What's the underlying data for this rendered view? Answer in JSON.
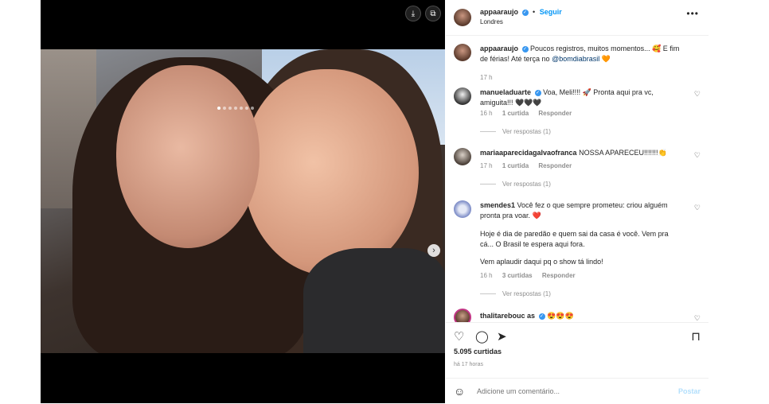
{
  "post": {
    "username": "appaaraujo",
    "follow_label": "Seguir",
    "location": "Londres",
    "caption_text": "Poucos registros, muitos momentos... 🥰 E fim de férias! Até terça no ",
    "caption_mention": "@bomdiabrasil",
    "caption_end": " 🧡",
    "caption_time": "17 h",
    "likes": "5.095 curtidas",
    "posted_ago": "há 17 horas"
  },
  "media": {
    "carousel_dots": 7,
    "active_dot": 1
  },
  "comments": [
    {
      "username": "manueladuarte",
      "verified": true,
      "text": "Voa, Meli!!!! 🚀 Pronta aqui pra vc, amiguita!!! 🖤🖤🖤",
      "time": "16 h",
      "likes": "1 curtida",
      "reply_label": "Responder",
      "view_replies": "Ver respostas (1)"
    },
    {
      "username": "mariaaparecidagalvaofranca",
      "verified": false,
      "text": "NOSSA APARECEU!!!!!!!👏",
      "time": "17 h",
      "likes": "1 curtida",
      "reply_label": "Responder",
      "view_replies": "Ver respostas (1)"
    },
    {
      "username": "smendes1",
      "verified": false,
      "text": "Você fez o que sempre prometeu: criou alguém pronta pra voar. ❤️",
      "text2": "Hoje é dia de paredão e quem sai da casa é você. Vem pra cá... O Brasil te espera aqui fora.",
      "text3": "Vem aplaudir daqui pq o show tá lindo!",
      "time": "16 h",
      "likes": "3 curtidas",
      "reply_label": "Responder",
      "view_replies": "Ver respostas (1)"
    },
    {
      "username": "thalitarebouc as",
      "verified": true,
      "text": "😍😍😍"
    }
  ],
  "comment_box": {
    "placeholder": "Adicione um comentário...",
    "post_label": "Postar"
  },
  "icons": {
    "heart": "♡",
    "comment": "◯",
    "share": "➤",
    "bookmark": "⊓",
    "emoji": "☺",
    "more": "•••",
    "next": "›",
    "download": "⤓",
    "external": "⧉"
  },
  "colors": {
    "accent": "#0095f6",
    "verified": "#3897f0",
    "muted": "#8e8e8e"
  }
}
